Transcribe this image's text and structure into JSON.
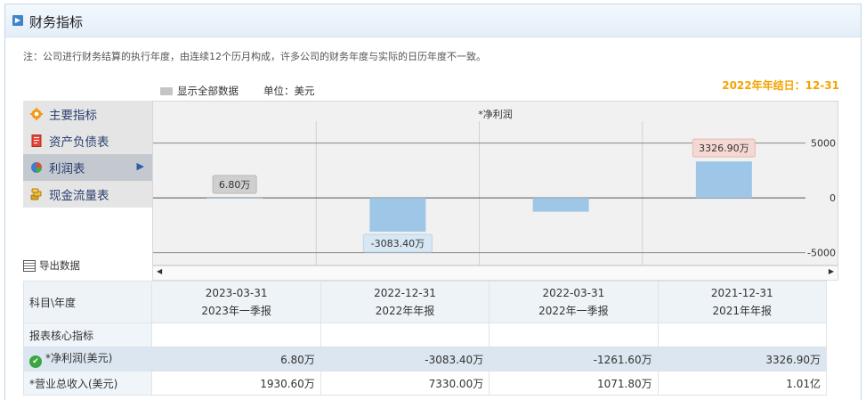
{
  "header": {
    "title": "财务指标"
  },
  "note": "注：公司进行财务结算的执行年度，由连续12个历月构成，许多公司的财务年度与实际的日历年度不一致。",
  "fiscal_year_end": "2022年年结日：12-31",
  "options": {
    "show_all": "显示全部数据",
    "unit": "单位：美元"
  },
  "sidebar": {
    "items": [
      {
        "label": "主要指标"
      },
      {
        "label": "资产负债表"
      },
      {
        "label": "利润表"
      },
      {
        "label": "现金流量表"
      }
    ]
  },
  "export_label": "导出数据",
  "chart_data": {
    "type": "bar",
    "title": "*净利润",
    "categories": [
      "2023-03-31",
      "2022-12-31",
      "2022-03-31",
      "2021-12-31"
    ],
    "values": [
      6.8,
      -3083.4,
      -1261.6,
      3326.9
    ],
    "data_labels": [
      "6.80万",
      "-3083.40万",
      "",
      "3326.90万"
    ],
    "y_ticks": [
      5000,
      0,
      -5000
    ],
    "y_tick_labels": [
      "5000",
      "0",
      "-5000"
    ],
    "ylim": [
      -6250,
      7000
    ],
    "grid": true,
    "bar_color": "#9ec6e6"
  },
  "table": {
    "corner": "科目\\年度",
    "periods": [
      {
        "date": "2023-03-31",
        "type": "2023年一季报"
      },
      {
        "date": "2022-12-31",
        "type": "2022年年报"
      },
      {
        "date": "2022-03-31",
        "type": "2022年一季报"
      },
      {
        "date": "2021-12-31",
        "type": "2021年年报"
      }
    ],
    "section": "报表核心指标",
    "rows": [
      {
        "label": "*净利润(美元)",
        "values": [
          "6.80万",
          "-3083.40万",
          "-1261.60万",
          "3326.90万"
        ]
      },
      {
        "label": "*营业总收入(美元)",
        "values": [
          "1930.60万",
          "7330.00万",
          "1071.80万",
          "1.01亿"
        ]
      }
    ]
  },
  "colors": {
    "accent": "#3f84c9",
    "fiscal_year": "#f5a300",
    "check": "#3aa641"
  }
}
